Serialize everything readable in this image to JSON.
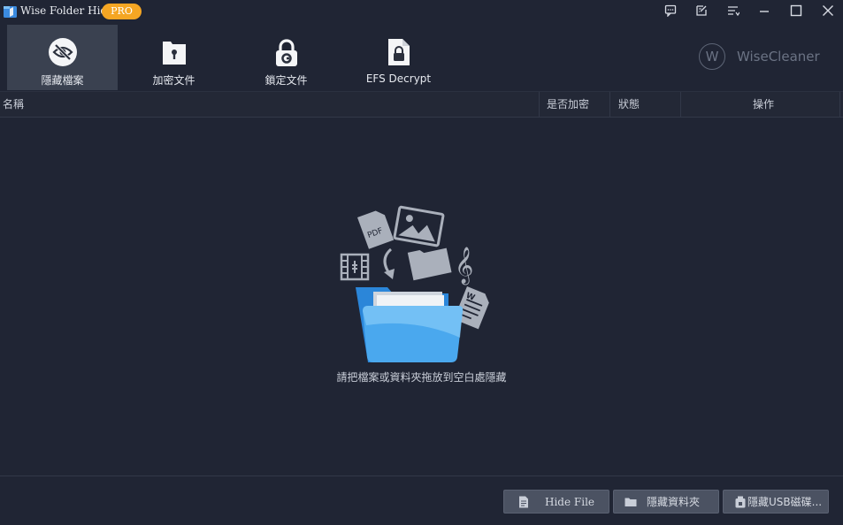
{
  "window": {
    "title": "Wise Folder Hider",
    "badge": "PRO",
    "controls": [
      "feedback-icon",
      "edit-icon",
      "menu-icon",
      "minimize-icon",
      "maximize-icon",
      "close-icon"
    ]
  },
  "tabs": [
    {
      "label": "隱藏檔案",
      "icon": "eye-slash-icon",
      "active": true
    },
    {
      "label": "加密文件",
      "icon": "file-keyhole-icon",
      "active": false
    },
    {
      "label": "鎖定文件",
      "icon": "padlock-icon",
      "active": false
    },
    {
      "label": "EFS Decrypt",
      "icon": "file-lock-icon",
      "active": false
    }
  ],
  "brand": {
    "logo_letter": "W",
    "name": "WiseCleaner"
  },
  "table": {
    "columns": [
      "名稱",
      "是否加密",
      "狀態",
      "操作"
    ]
  },
  "drop_area": {
    "pdf_label": "PDF",
    "hint": "請把檔案或資料夾拖放到空白處隱藏"
  },
  "actions": {
    "hide_file": "Hide File",
    "hide_folder": "隱藏資料夾",
    "hide_usb": "隱藏USB磁碟..."
  },
  "colors": {
    "background": "#202534",
    "active_tab": "#3a4150",
    "badge": "#f5a623",
    "button": "#4b5262"
  }
}
